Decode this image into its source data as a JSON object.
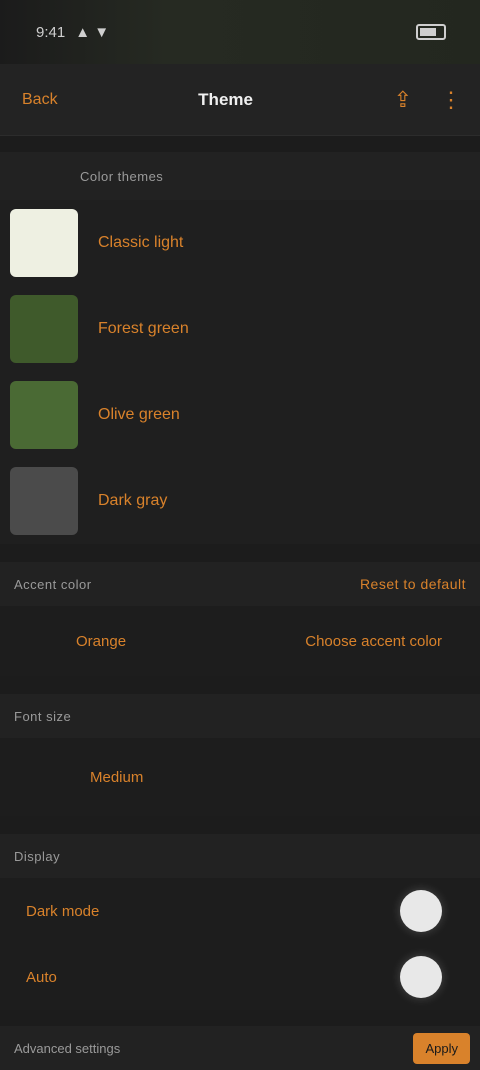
{
  "status": {
    "time": "9:41",
    "signal": "▲ ▼",
    "battery_icon": "battery-icon"
  },
  "nav": {
    "back_label": "Back",
    "title": "Theme",
    "action1_icon": "share-icon",
    "action2_icon": "more-icon"
  },
  "themes_section": {
    "title": "Color themes"
  },
  "themes": [
    {
      "label": "Classic light",
      "color": "#eef0e2"
    },
    {
      "label": "Forest green",
      "color": "#3f5a2b"
    },
    {
      "label": "Olive green",
      "color": "#4a6a34"
    },
    {
      "label": "Dark gray",
      "color": "#4b4b4b"
    }
  ],
  "accent_section": {
    "title": "Accent color",
    "action": "Reset to default"
  },
  "accent_row": {
    "left": "Orange",
    "right": "Choose accent color"
  },
  "font_section": {
    "title": "Font size"
  },
  "font_row": {
    "value": "Medium"
  },
  "display_section": {
    "title": "Display"
  },
  "display_rows": [
    {
      "label": "Dark mode"
    },
    {
      "label": "Auto"
    }
  ],
  "footer": {
    "title": "Advanced settings",
    "button": "Apply"
  }
}
